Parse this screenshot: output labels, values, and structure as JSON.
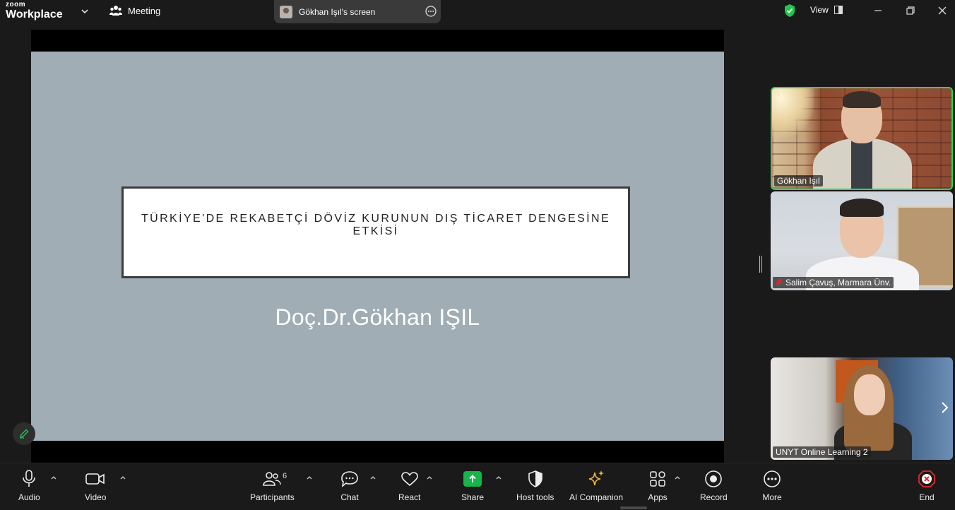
{
  "app": {
    "logo_small": "zoom",
    "logo_big": "Workplace",
    "meeting_label": "Meeting",
    "screen_share_label": "Gökhan Işıl's screen",
    "view_label": "View",
    "security_color": "#23c552"
  },
  "slide": {
    "title": "TÜRKİYE'DE REKABETÇİ DÖVİZ KURUNUN DIŞ TİCARET DENGESİNE ETKİSİ",
    "author": "Doç.Dr.Gökhan IŞIL",
    "background": "#a0adb5"
  },
  "participants_videos": [
    {
      "name": "Gökhan Işıl",
      "active_speaker": true
    },
    {
      "name": "Salim Çavuş, Marmara Ünv.",
      "muted": true
    },
    {
      "name": "UNYT Online Learning 2"
    }
  ],
  "toolbar": {
    "audio": "Audio",
    "video": "Video",
    "participants": "Participants",
    "participants_count": "6",
    "chat": "Chat",
    "react": "React",
    "share": "Share",
    "host_tools": "Host tools",
    "ai_companion": "AI Companion",
    "apps": "Apps",
    "record": "Record",
    "more": "More",
    "end": "End",
    "share_color": "#18b34a",
    "end_color": "#e02828"
  }
}
